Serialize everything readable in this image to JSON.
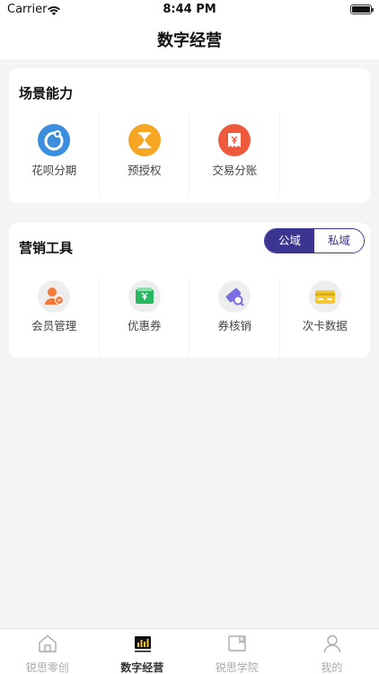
{
  "status_bar": {
    "carrier": "Carrier",
    "time": "8:44 PM"
  },
  "nav": {
    "title": "数字经营"
  },
  "scene_section": {
    "title": "场景能力",
    "items": [
      {
        "label": "花呗分期",
        "icon": "huabei-installment-icon",
        "color": "#3b8ede"
      },
      {
        "label": "预授权",
        "icon": "hourglass-icon",
        "color": "#f6a623"
      },
      {
        "label": "交易分账",
        "icon": "split-bill-icon",
        "color": "#f05a3c"
      }
    ]
  },
  "marketing_section": {
    "title": "营销工具",
    "toggle": {
      "public": "公域",
      "private": "私域",
      "selected": "公域"
    },
    "items": [
      {
        "label": "会员管理",
        "icon": "member-icon",
        "color": "#f5793b"
      },
      {
        "label": "优惠券",
        "icon": "coupon-icon",
        "color": "#28b864"
      },
      {
        "label": "券核销",
        "icon": "coupon-verify-icon",
        "color": "#7b6ee0"
      },
      {
        "label": "次卡数据",
        "icon": "punch-card-icon",
        "color": "#f4c935"
      }
    ]
  },
  "tabbar": {
    "items": [
      {
        "label": "锐思零创",
        "icon": "home-icon",
        "active": false
      },
      {
        "label": "数字经营",
        "icon": "chart-icon",
        "active": true
      },
      {
        "label": "锐思学院",
        "icon": "book-icon",
        "active": false
      },
      {
        "label": "我的",
        "icon": "profile-icon",
        "active": false
      }
    ]
  },
  "colors": {
    "accent": "#3c3491",
    "background": "#f4f4f4"
  }
}
